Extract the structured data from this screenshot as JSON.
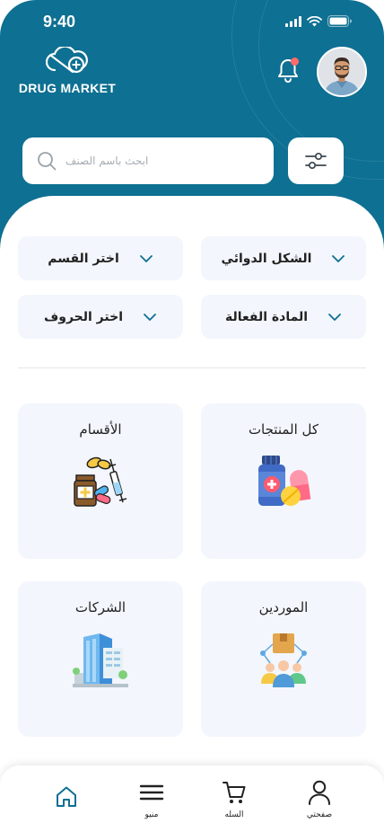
{
  "colors": {
    "brand": "#0e7092",
    "card_bg": "#f3f6fc",
    "notification_dot": "#ff6b6b"
  },
  "status_bar": {
    "time": "9:40",
    "icons": [
      "signal-icon",
      "wifi-icon",
      "battery-icon"
    ]
  },
  "header": {
    "logo_text": "DRUG MARKET",
    "notification_icon": "bell-icon",
    "has_notification": true
  },
  "search": {
    "placeholder": "ابحث باسم الصنف",
    "value": "",
    "icon": "search-icon",
    "filter_icon": "sliders-icon"
  },
  "filters": [
    {
      "label": "الشكل الدوائي",
      "icon": "chevron-down-icon"
    },
    {
      "label": "اختر القسم",
      "icon": "chevron-down-icon"
    },
    {
      "label": "المادة الفعالة",
      "icon": "chevron-down-icon"
    },
    {
      "label": "اختر الحروف",
      "icon": "chevron-down-icon"
    }
  ],
  "categories": [
    {
      "label": "كل المنتجات",
      "icon": "medicine-bottle-icon"
    },
    {
      "label": "الأقسام",
      "icon": "pharmacy-supplies-icon"
    },
    {
      "label": "الموردين",
      "icon": "suppliers-icon"
    },
    {
      "label": "الشركات",
      "icon": "company-building-icon"
    }
  ],
  "bottom_nav": [
    {
      "label": "صفحتي",
      "icon": "user-icon"
    },
    {
      "label": "السله",
      "icon": "cart-icon"
    },
    {
      "label": "منيو",
      "icon": "menu-icon"
    },
    {
      "label": "",
      "icon": "home-icon",
      "active": true
    }
  ]
}
